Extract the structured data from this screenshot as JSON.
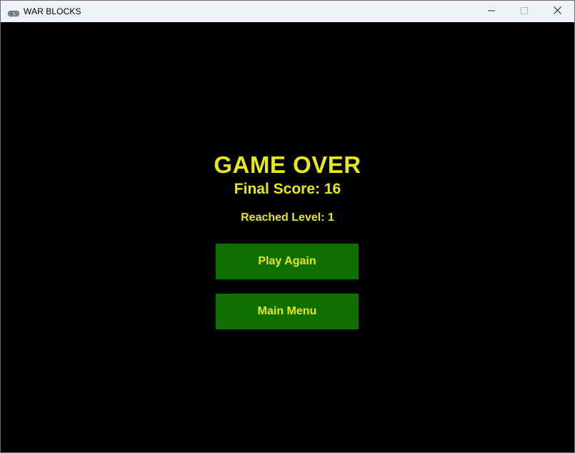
{
  "window": {
    "title": "WAR BLOCKS",
    "icon": "gamepad-icon"
  },
  "colors": {
    "text": "#e6e619",
    "button_bg": "#0f7000",
    "background": "#000000"
  },
  "game_over": {
    "title": "GAME OVER",
    "final_score_label": "Final Score: 16",
    "reached_level_label": "Reached Level: 1"
  },
  "buttons": {
    "play_again": "Play Again",
    "main_menu": "Main Menu"
  }
}
